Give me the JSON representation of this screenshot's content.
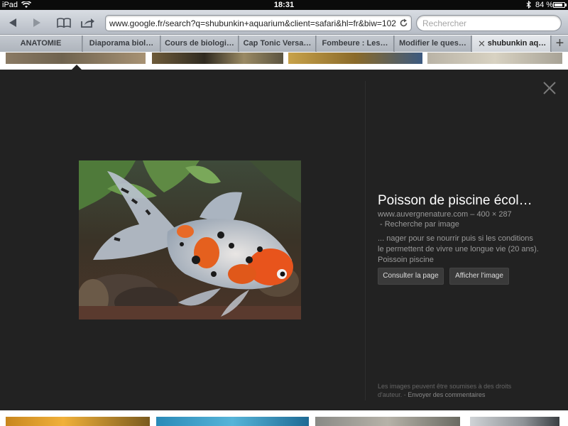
{
  "status": {
    "device": "iPad",
    "time": "18:31",
    "battery": "84 %",
    "battery_level": 0.84
  },
  "toolbar": {
    "url": "www.google.fr/search?q=shubunkin+aquarium&client=safari&hl=fr&biw=1024",
    "search_placeholder": "Rechercher"
  },
  "tabs": [
    {
      "label": "ANATOMIE"
    },
    {
      "label": "Diaporama biol…"
    },
    {
      "label": "Cours de biologi…"
    },
    {
      "label": "Cap Tonic Versa…"
    },
    {
      "label": "Fombeure : Les…"
    },
    {
      "label": "Modifier le ques…"
    },
    {
      "label": "shubunkin aq…",
      "active": true
    }
  ],
  "new_tab": "+",
  "viewer": {
    "title": "Poisson de piscine écol…",
    "source": "www.auvergnenature.com",
    "separator": "–",
    "dimensions": "400 × 287",
    "search_by_image": "Recherche par image",
    "search_by_image_prefix": "-",
    "description": "... nager pour se nourrir puis si les conditions le permettent de vivre une longue vie (20 ans). Poissoin piscine",
    "btn_visit": "Consulter la page",
    "btn_view": "Afficher l'image",
    "rights_note": "Les images peuvent être soumises à des droits d'auteur.",
    "feedback_sep": "-",
    "feedback": "Envoyer des commentaires"
  },
  "colors": {
    "viewer_bg": "#222222",
    "toolbar_top": "#d9dde3",
    "toolbar_bottom": "#b6bcc5"
  }
}
